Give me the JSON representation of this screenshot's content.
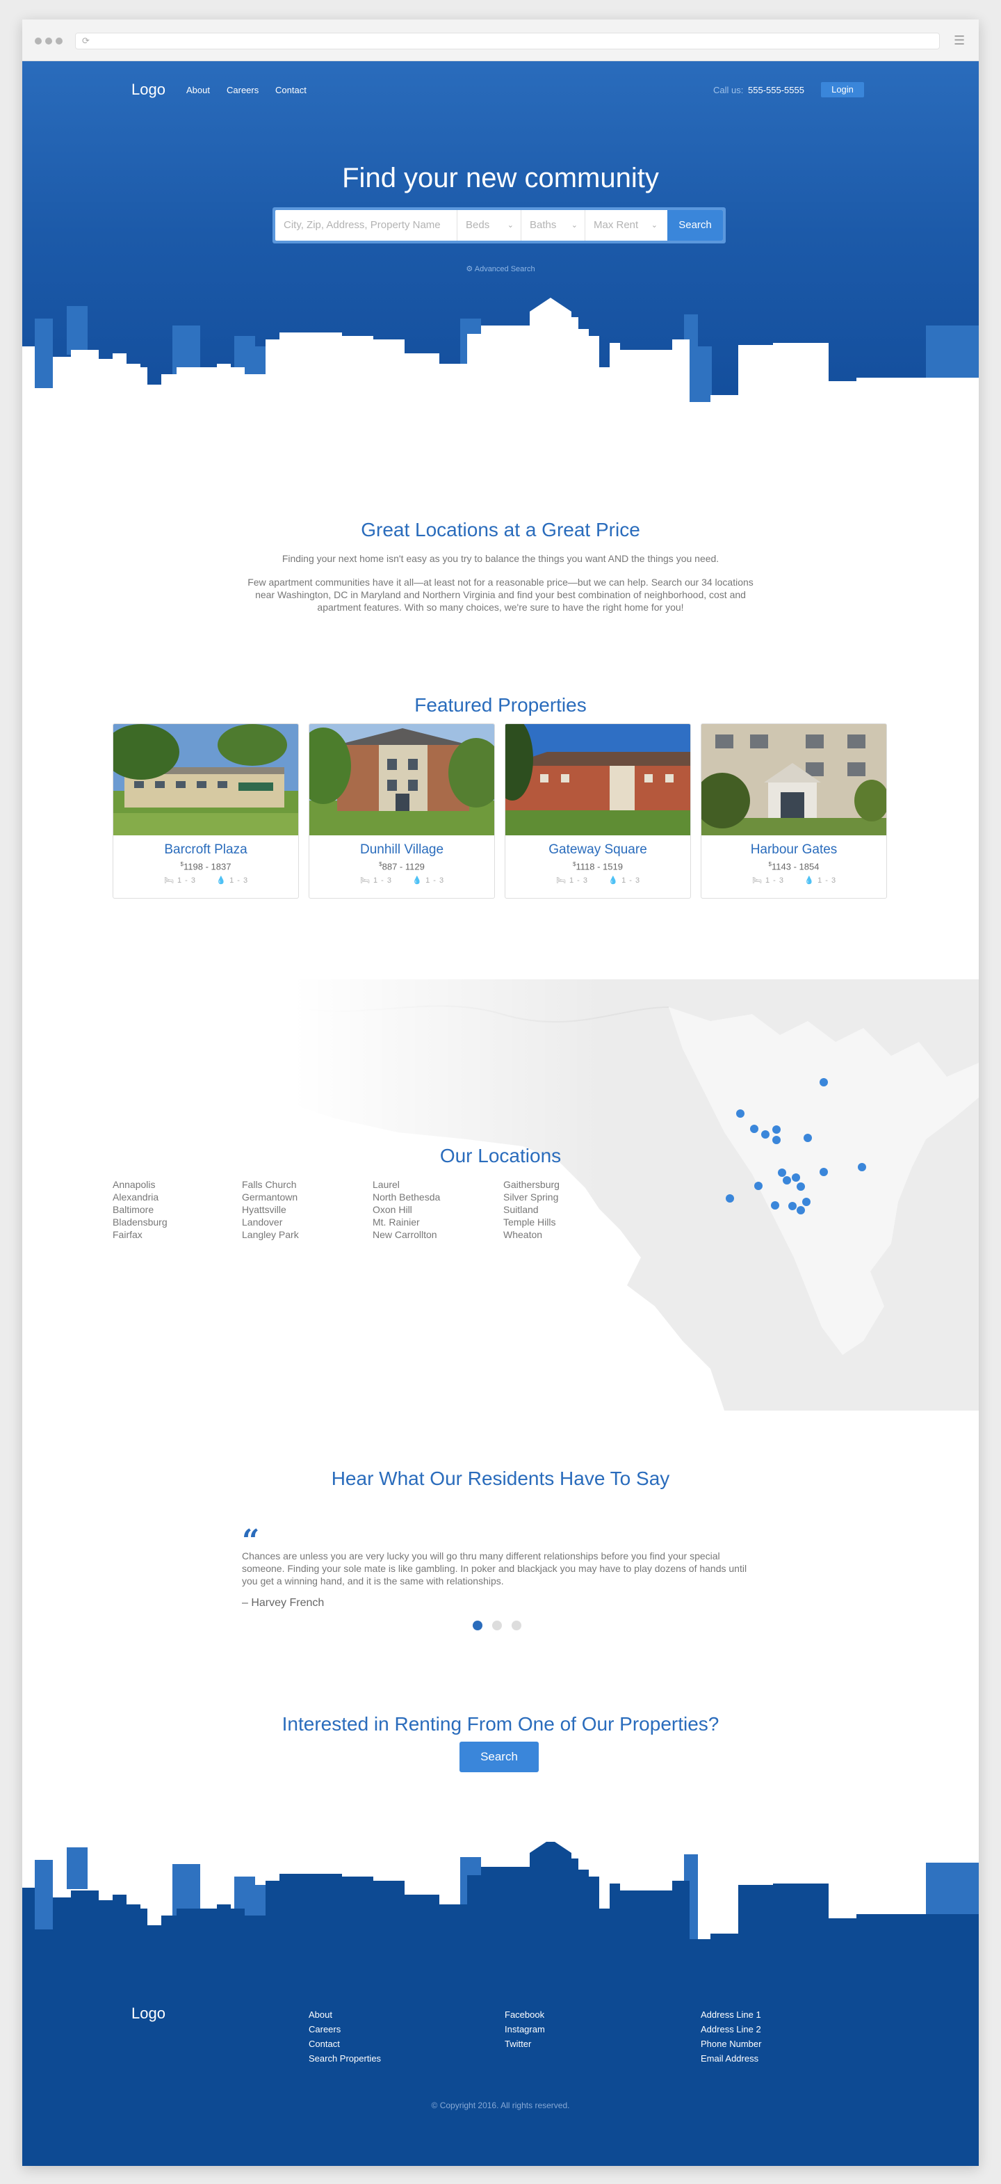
{
  "nav": {
    "logo": "Logo",
    "about": "About",
    "careers": "Careers",
    "contact": "Contact",
    "call_label": "Call us:",
    "phone": "555-555-5555",
    "login": "Login"
  },
  "hero": {
    "title": "Find your new community",
    "search_placeholder": "City, Zip, Address, Property Name",
    "beds": "Beds",
    "baths": "Baths",
    "max_rent": "Max Rent",
    "search_button": "Search",
    "advanced": "Advanced Search"
  },
  "intro": {
    "title": "Great Locations at a Great Price",
    "p1": "Finding your next home isn't easy as you try to balance the things you want AND the things you need.",
    "p2": "Few apartment communities have it all—at least not for a reasonable price—but we can help. Search our 34 locations near Washington, DC in Maryland and Northern Virginia and find your best combination of neighborhood, cost and apartment features. With so many choices, we're sure to have the right home for you!"
  },
  "featured": {
    "title": "Featured Properties",
    "properties": [
      {
        "name": "Barcroft Plaza",
        "currency": "$",
        "price": "1198 - 1837",
        "beds": "1 - 3",
        "baths": "1 - 3"
      },
      {
        "name": "Dunhill Village",
        "currency": "$",
        "price": "887 - 1129",
        "beds": "1 - 3",
        "baths": "1 - 3"
      },
      {
        "name": "Gateway Square",
        "currency": "$",
        "price": "1118 - 1519",
        "beds": "1 - 3",
        "baths": "1 - 3"
      },
      {
        "name": "Harbour Gates",
        "currency": "$",
        "price": "1143 - 1854",
        "beds": "1 - 3",
        "baths": "1 - 3"
      }
    ]
  },
  "locations": {
    "title": "Our Locations",
    "columns": [
      [
        "Annapolis",
        "Alexandria",
        "Baltimore",
        "Bladensburg",
        "Fairfax"
      ],
      [
        "Falls Church",
        "Germantown",
        "Hyattsville",
        "Landover",
        "Langley Park"
      ],
      [
        "Laurel",
        "North Bethesda",
        "Oxon Hill",
        "Mt. Rainier",
        "New Carrollton"
      ],
      [
        "Gaithersburg",
        "Silver Spring",
        "Suitland",
        "Temple Hills",
        "Wheaton"
      ]
    ]
  },
  "testimonials": {
    "title": "Hear What Our Residents Have To Say",
    "quote": "Chances are unless you are very lucky you will go thru many different relationships before you find your special someone. Finding your sole mate is like gambling. In poker and blackjack you may have to play dozens of hands until you get a winning hand, and it is the same with relationships.",
    "author": "– Harvey French",
    "active_slide": 1,
    "slide_count": 3
  },
  "cta": {
    "title": "Interested in Renting From One of Our Properties?",
    "button": "Search"
  },
  "footer": {
    "logo": "Logo",
    "links1": [
      "About",
      "Careers",
      "Contact",
      "Search Properties"
    ],
    "links2": [
      "Facebook",
      "Instagram",
      "Twitter"
    ],
    "address": [
      "Address Line 1",
      "Address Line 2",
      "Phone Number",
      "Email Address"
    ],
    "copyright": "© Copyright 2016. All rights reserved."
  },
  "colors": {
    "brand": "#2a6cbc",
    "accent": "#3a86da",
    "footer": "#0d4a93"
  }
}
